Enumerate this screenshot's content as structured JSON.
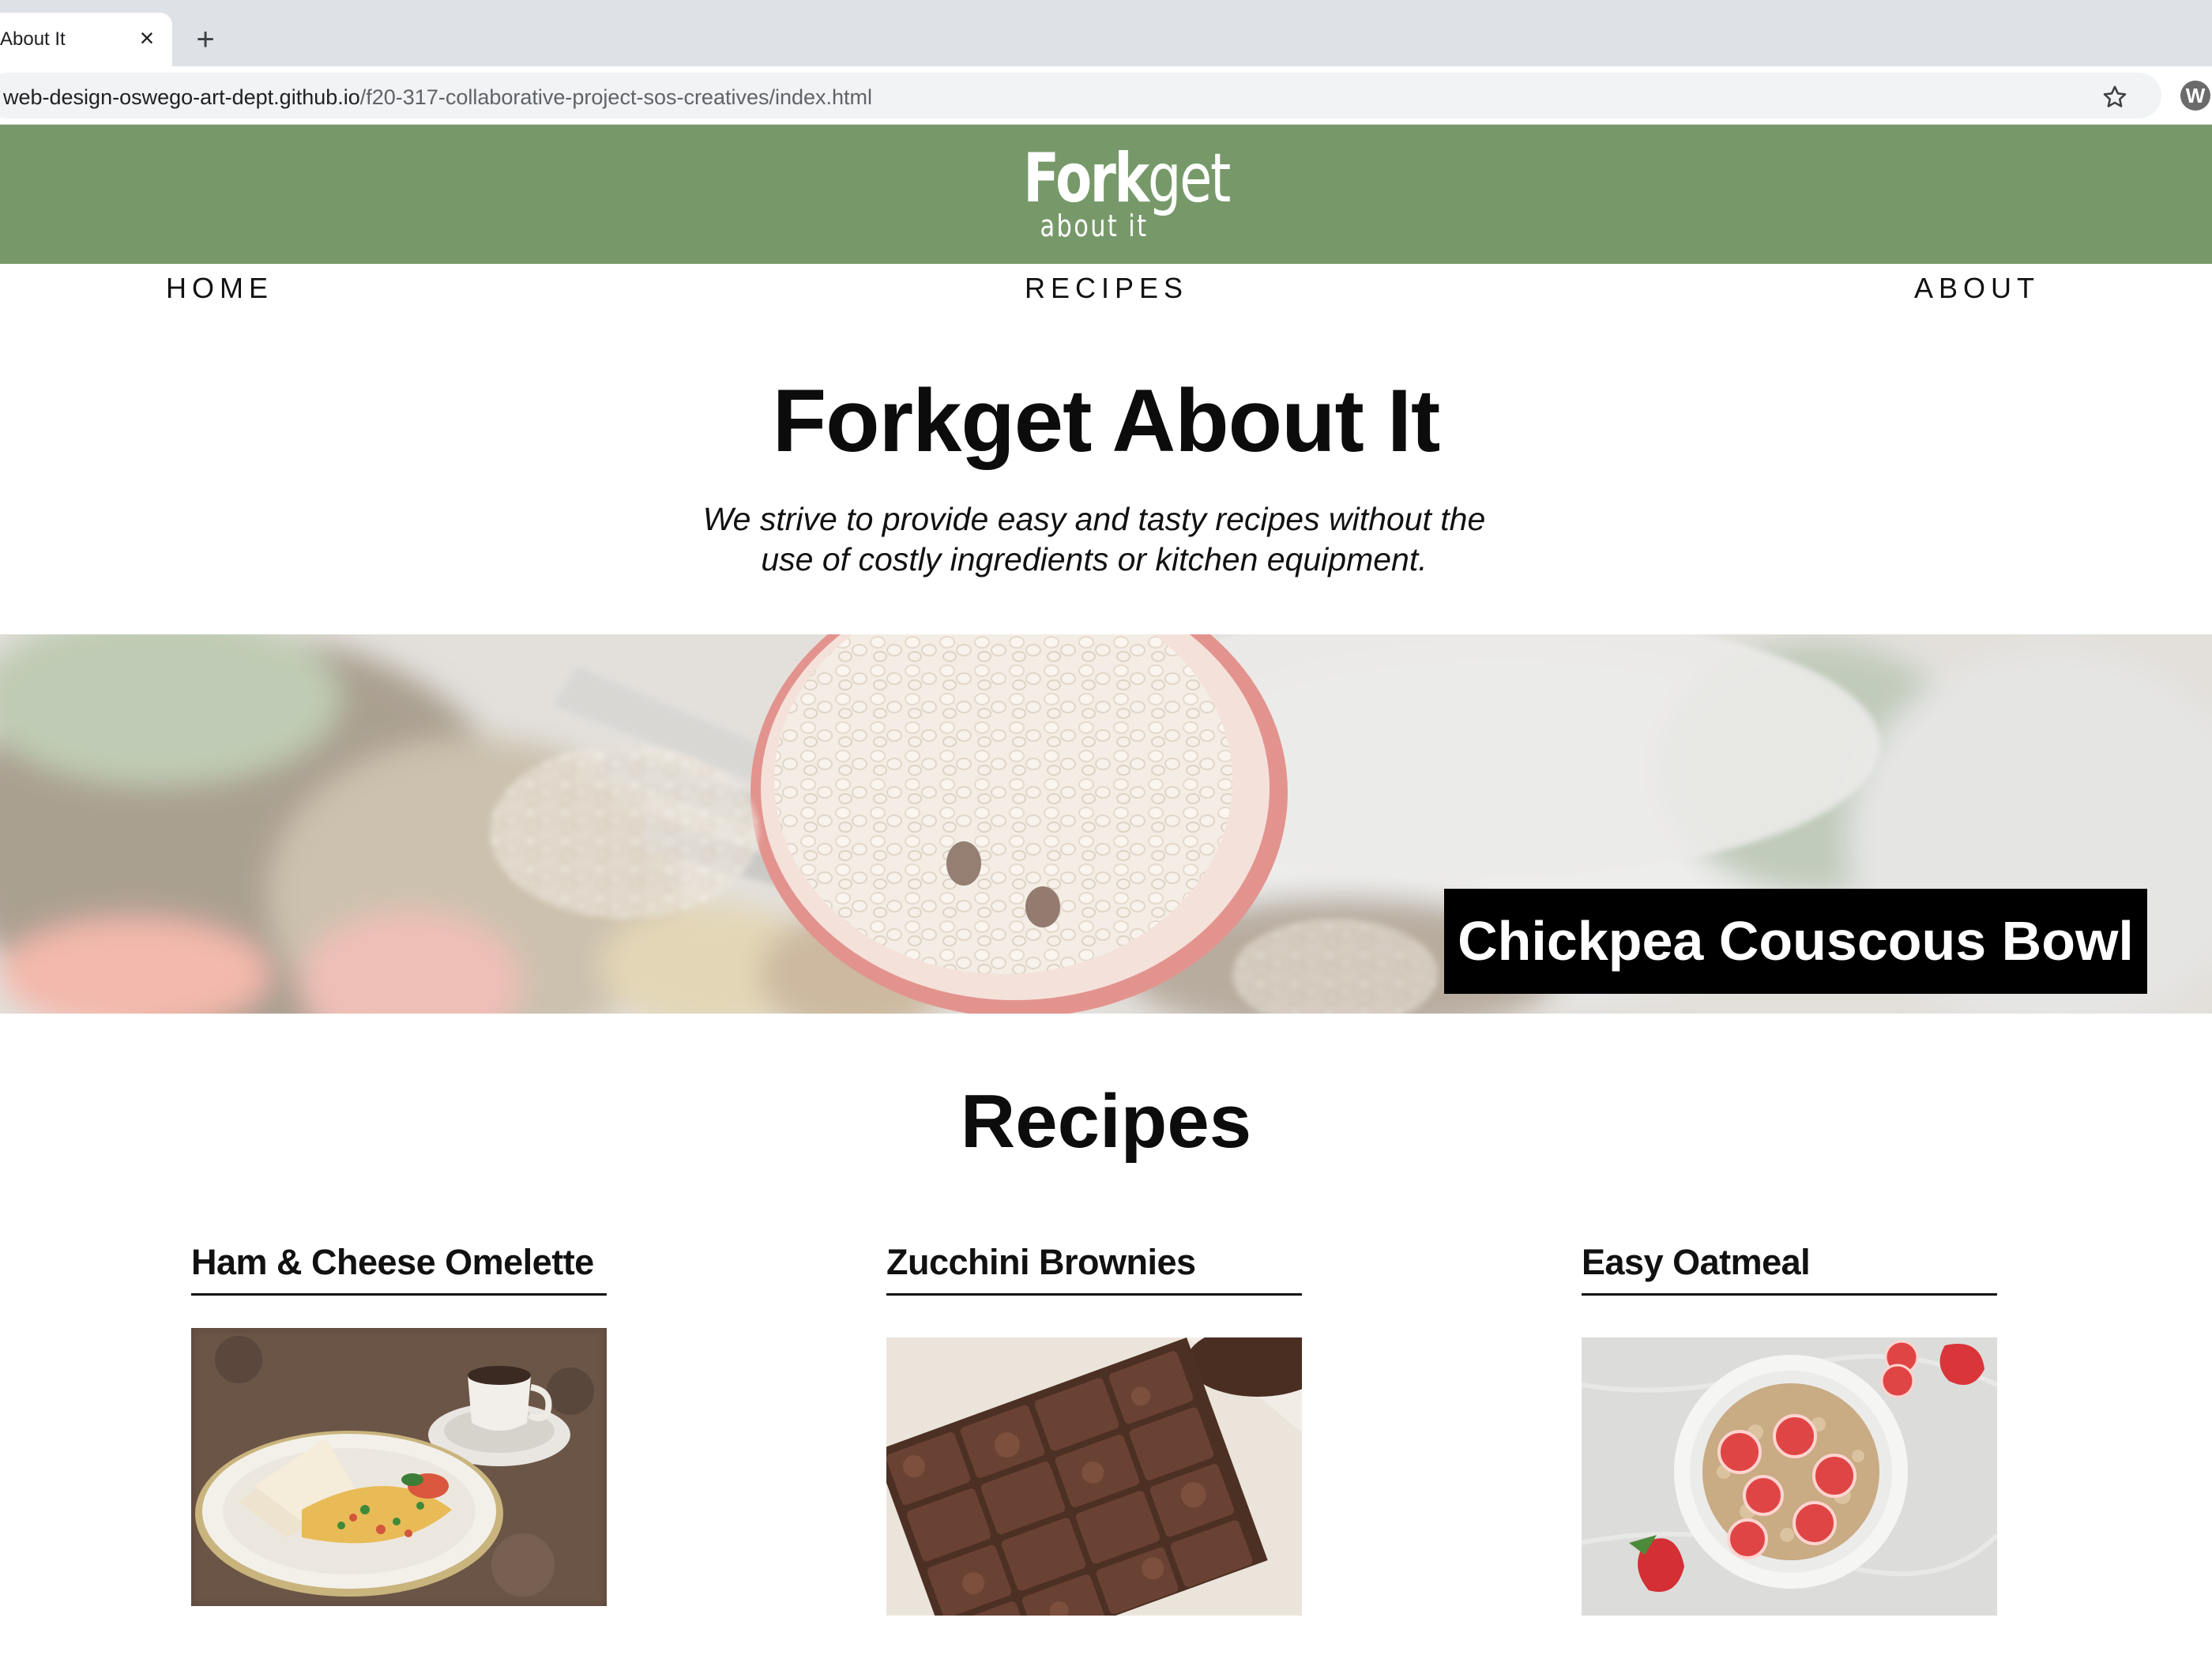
{
  "browser": {
    "tab_title": "About It",
    "tab_close": "×",
    "new_tab": "+",
    "url_host": "web-design-oswego-art-dept.github.io",
    "url_path": "/f20-317-collaborative-project-sos-creatives/index.html",
    "extension_label": "W"
  },
  "header": {
    "logo_part1": "Fork",
    "logo_part2": "get",
    "logo_sub": "about it",
    "bg_color": "#77996a"
  },
  "nav": {
    "home": "HOME",
    "recipes": "RECIPES",
    "about": "ABOUT"
  },
  "hero": {
    "title": "Forkget About It",
    "tagline": "We strive to provide easy and tasty recipes without the use of costly ingredients or kitchen equipment."
  },
  "banner": {
    "caption": "Chickpea Couscous Bowl"
  },
  "recipes": {
    "title": "Recipes",
    "cards": [
      {
        "title": "Ham & Cheese Omelette"
      },
      {
        "title": "Zucchini Brownies"
      },
      {
        "title": "Easy Oatmeal"
      }
    ]
  }
}
